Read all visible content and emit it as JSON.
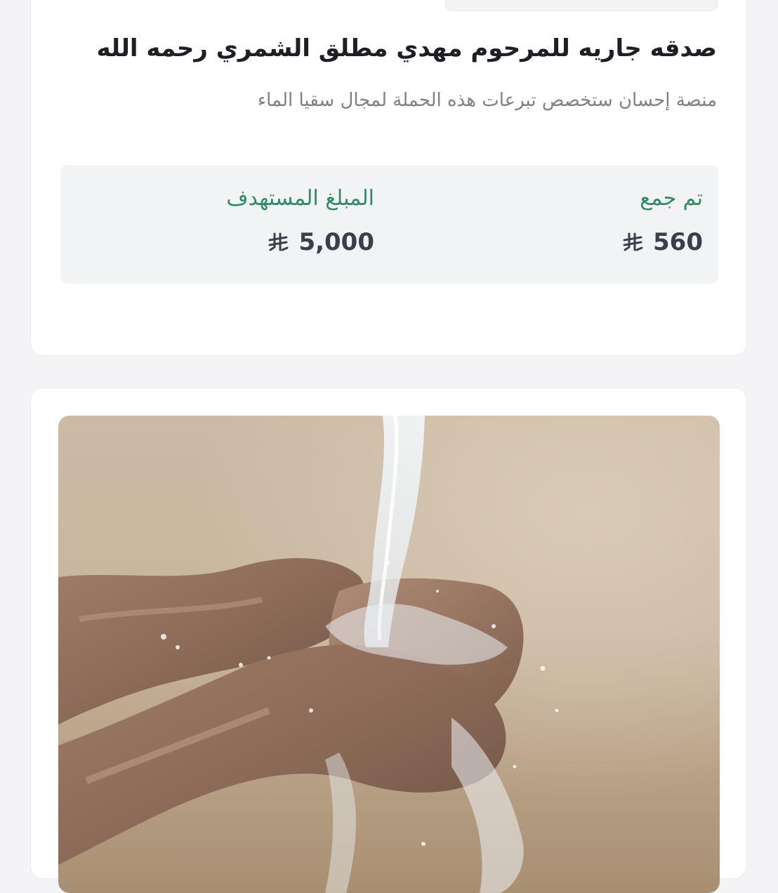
{
  "campaign": {
    "title": "صدقه جاريه للمرحوم مهدي مطلق الشمري رحمه الله",
    "description": "منصة إحسان ستخصص تبرعات هذه الحملة لمجال سقيا الماء"
  },
  "stats": {
    "collected_label": "تم جمع",
    "collected_value": "560",
    "target_label": "المبلغ المستهدف",
    "target_value": "5,000",
    "currency_icon": "saudi-riyal-icon"
  },
  "colors": {
    "accent_green": "#2f8a63",
    "title": "#1d1f25",
    "muted": "#7d8088"
  },
  "image": {
    "icon": "hands-with-water-photo"
  }
}
